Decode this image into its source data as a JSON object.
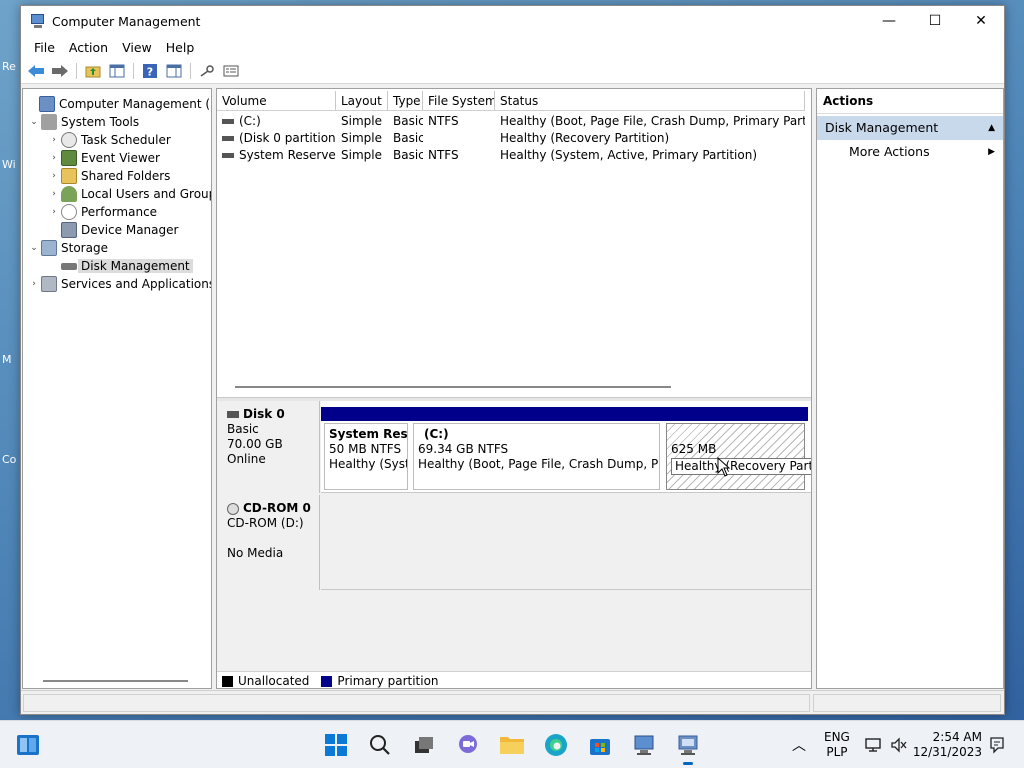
{
  "desktop": {
    "icon_labels": [
      "Re",
      "Wi",
      "M",
      "Co"
    ]
  },
  "window": {
    "title": "Computer Management",
    "controls": {
      "minimize": "—",
      "maximize": "☐",
      "close": "✕"
    }
  },
  "menu": [
    "File",
    "Action",
    "View",
    "Help"
  ],
  "tree": {
    "root": "Computer Management (Local",
    "system_tools": "System Tools",
    "task_scheduler": "Task Scheduler",
    "event_viewer": "Event Viewer",
    "shared_folders": "Shared Folders",
    "local_users": "Local Users and Groups",
    "performance": "Performance",
    "device_manager": "Device Manager",
    "storage": "Storage",
    "disk_management": "Disk Management",
    "services": "Services and Applications"
  },
  "volume_table": {
    "headers": [
      "Volume",
      "Layout",
      "Type",
      "File System",
      "Status"
    ],
    "rows": [
      [
        "(C:)",
        "Simple",
        "Basic",
        "NTFS",
        "Healthy (Boot, Page File, Crash Dump, Primary Partition)"
      ],
      [
        "(Disk 0 partition 3)",
        "Simple",
        "Basic",
        "",
        "Healthy (Recovery Partition)"
      ],
      [
        "System Reserved",
        "Simple",
        "Basic",
        "NTFS",
        "Healthy (System, Active, Primary Partition)"
      ]
    ]
  },
  "disks": {
    "disk0": {
      "name": "Disk 0",
      "type": "Basic",
      "size": "70.00 GB",
      "state": "Online",
      "partitions": [
        {
          "name": "System Reser",
          "size": "50 MB NTFS",
          "status": "Healthy (Syste"
        },
        {
          "name": "(C:)",
          "size": "69.34 GB NTFS",
          "status": "Healthy (Boot, Page File, Crash Dump, Primai"
        },
        {
          "name": "",
          "size": "625 MB",
          "status": "Healthy (Recovery Partition)"
        }
      ]
    },
    "cdrom0": {
      "name": "CD-ROM 0",
      "drive": "CD-ROM (D:)",
      "media": "No Media"
    }
  },
  "legend": {
    "unallocated": "Unallocated",
    "primary": "Primary partition",
    "unallocated_color": "#000000",
    "primary_color": "#00008b"
  },
  "actions": {
    "header": "Actions",
    "group": "Disk Management",
    "more": "More Actions"
  },
  "tray": {
    "lang1": "ENG",
    "lang2": "PLP",
    "time": "2:54 AM",
    "date": "12/31/2023"
  }
}
